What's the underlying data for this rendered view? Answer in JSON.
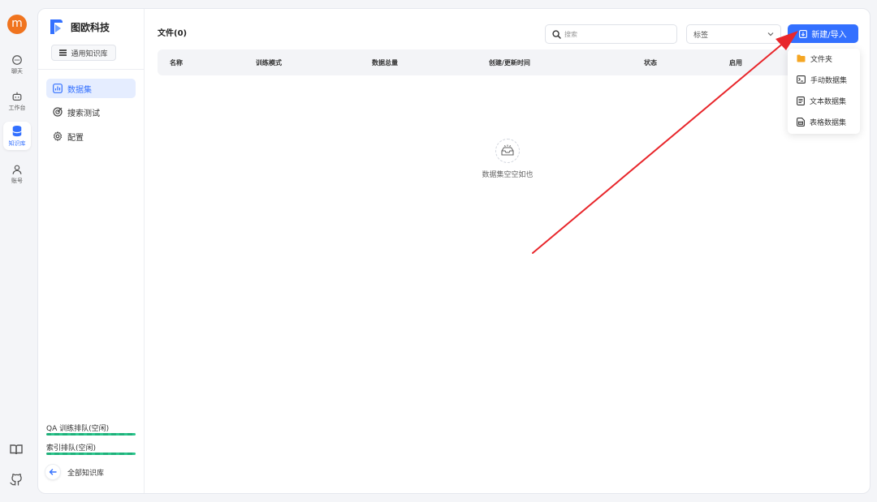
{
  "rail": {
    "avatar_letter": "m",
    "items": [
      {
        "label": "聊天",
        "icon": "chat-icon"
      },
      {
        "label": "工作台",
        "icon": "robot-icon"
      },
      {
        "label": "知识库",
        "icon": "database-icon"
      },
      {
        "label": "账号",
        "icon": "user-icon"
      }
    ],
    "bottom_icons": [
      "book-icon",
      "github-icon"
    ],
    "active": "知识库"
  },
  "sidebar": {
    "brand": "图欧科技",
    "kb_type": "通用知识库",
    "nav": [
      {
        "label": "数据集",
        "icon": "chart-icon",
        "active": true
      },
      {
        "label": "搜索测试",
        "icon": "target-icon",
        "active": false
      },
      {
        "label": "配置",
        "icon": "gear-icon",
        "active": false
      }
    ],
    "queues": [
      {
        "label": "QA 训练排队(空闲)"
      },
      {
        "label": "索引排队(空闲)"
      }
    ],
    "back_label": "全部知识库"
  },
  "main": {
    "title": "文件(0)",
    "search_placeholder": "搜索",
    "tag_select": "标签",
    "new_button": "新建/导入",
    "columns": [
      "名称",
      "训练模式",
      "数据总量",
      "创建/更新时间",
      "状态",
      "启用"
    ],
    "empty_text": "数据集空空如也"
  },
  "dropdown": {
    "items": [
      {
        "label": "文件夹",
        "icon": "folder-icon"
      },
      {
        "label": "手动数据集",
        "icon": "terminal-icon"
      },
      {
        "label": "文本数据集",
        "icon": "text-doc-icon"
      },
      {
        "label": "表格数据集",
        "icon": "table-doc-icon"
      }
    ]
  },
  "colors": {
    "accent": "#3370ff",
    "avatar": "#f0741f",
    "queue_bar": "#1fb07a",
    "annotation_arrow": "#e8262b",
    "folder": "#f5a623"
  }
}
